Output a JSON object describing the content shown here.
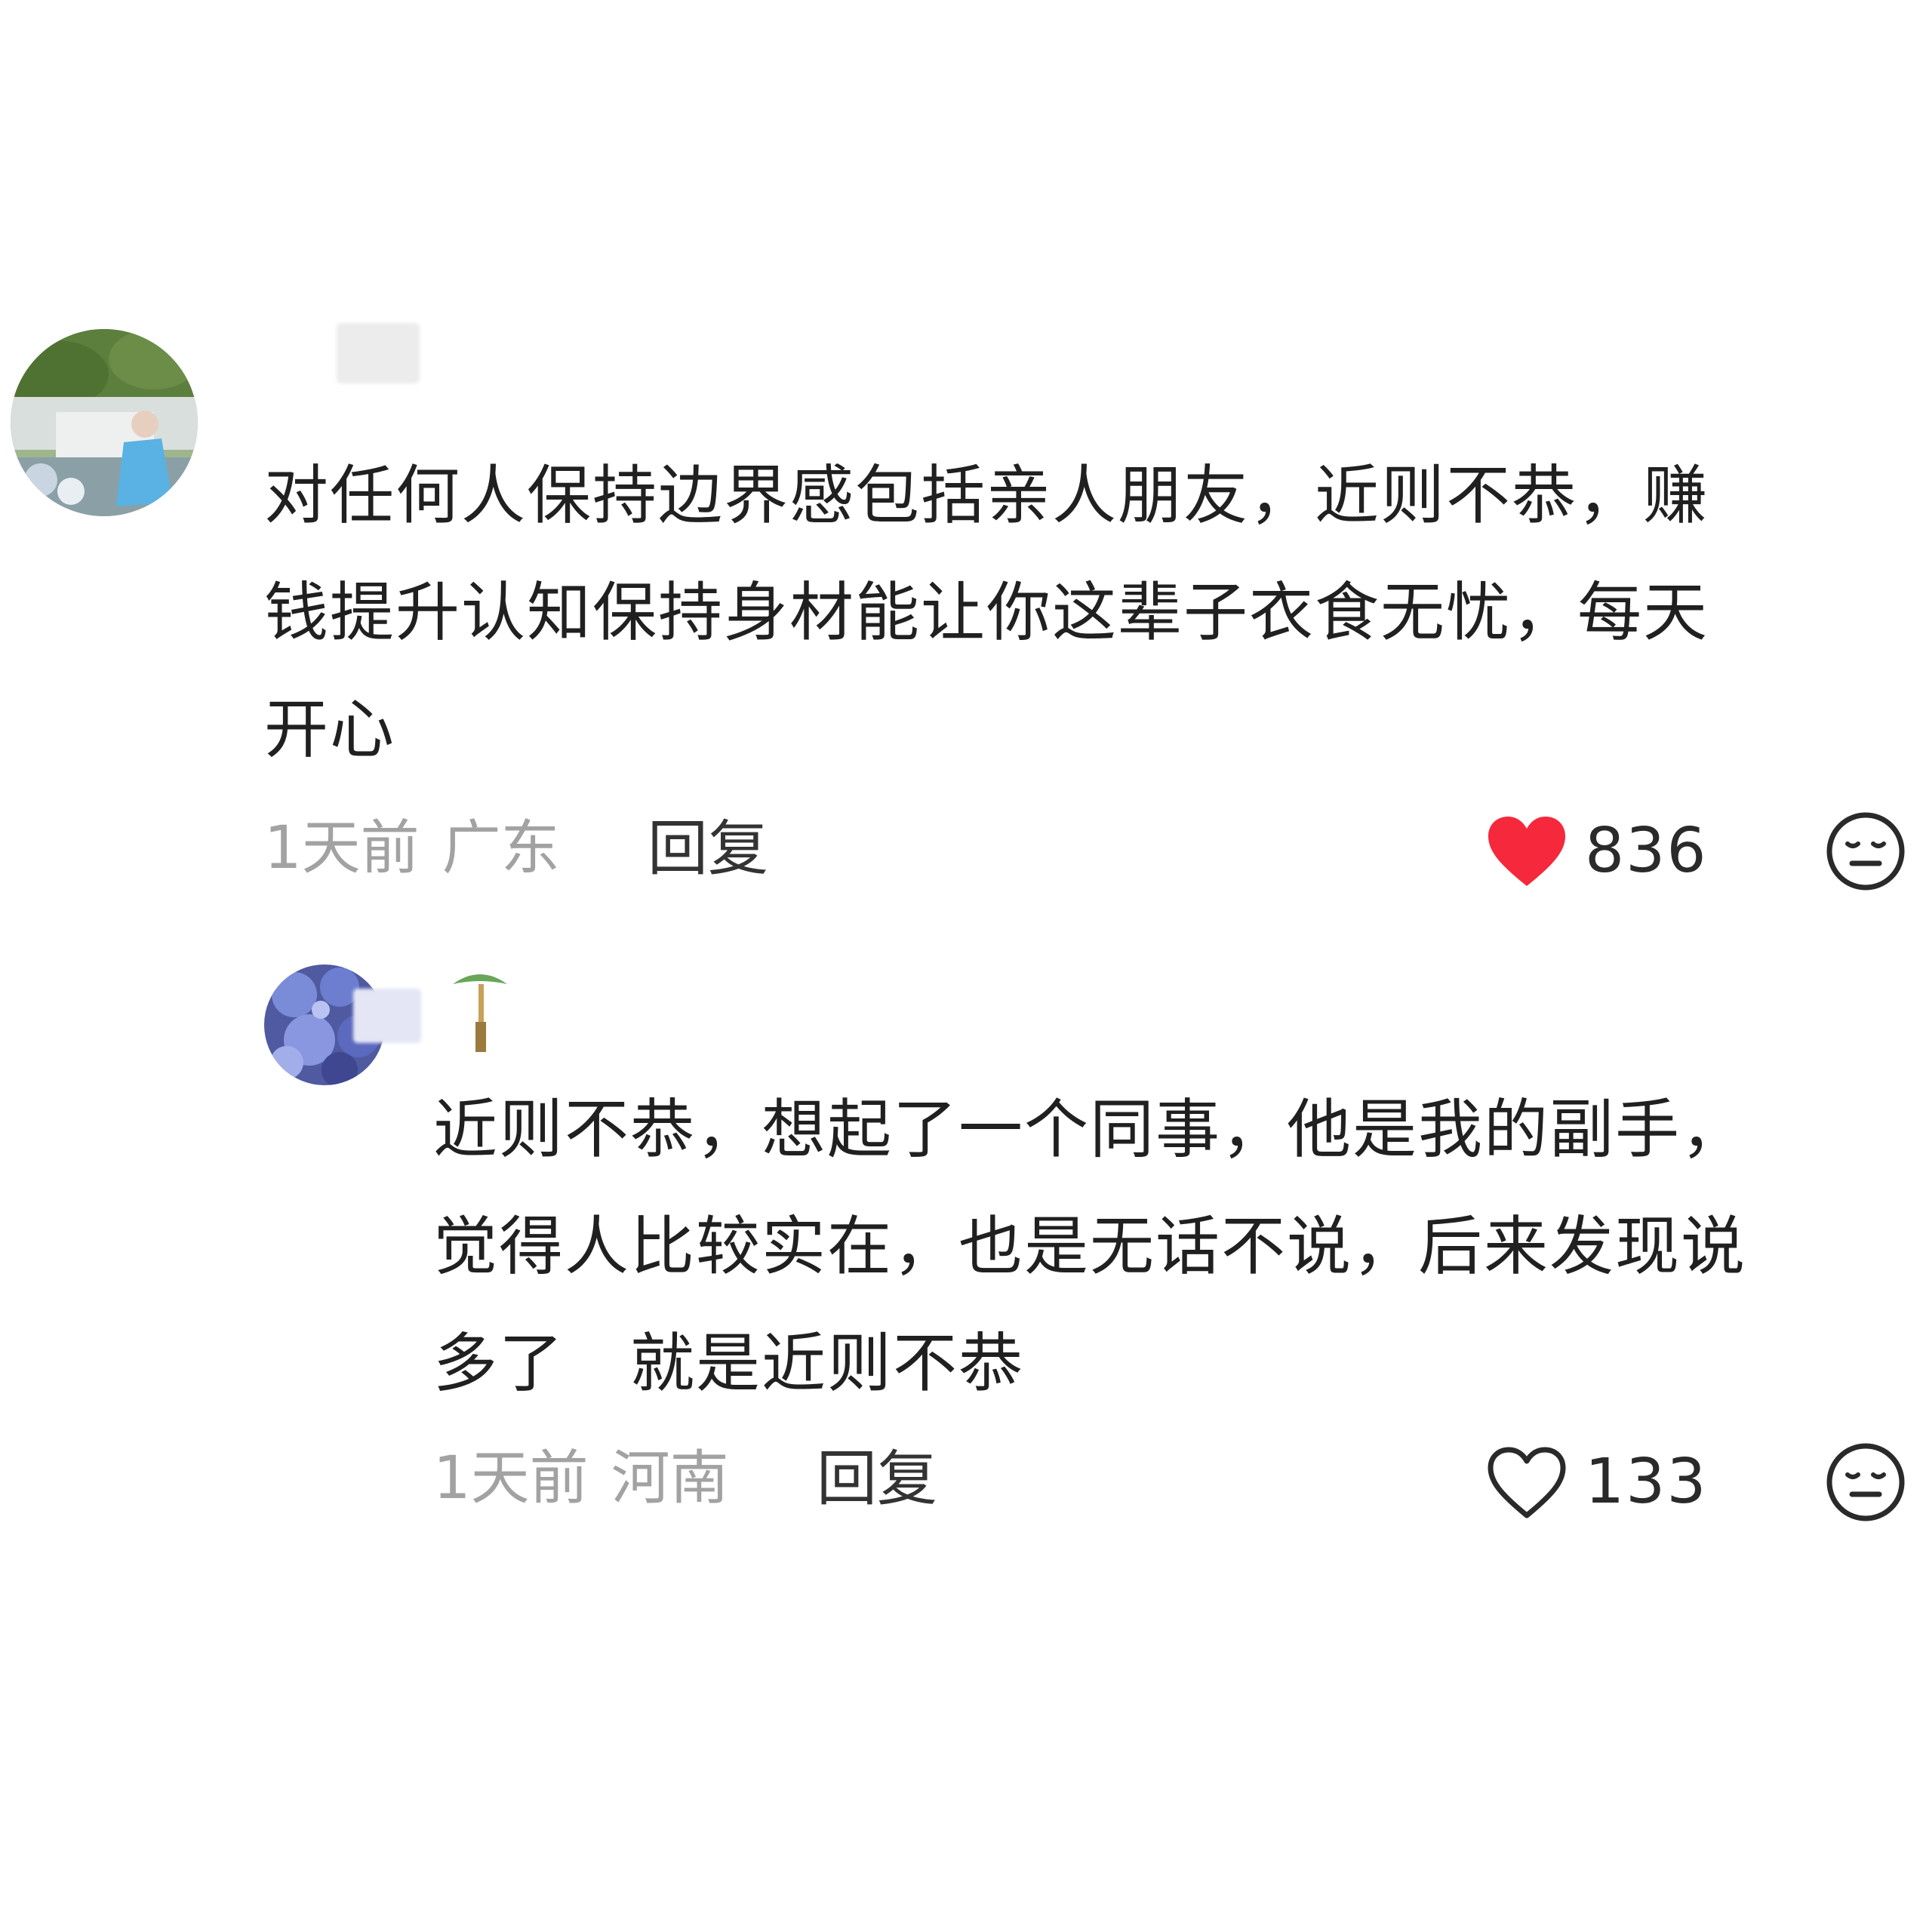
{
  "comments": [
    {
      "username": "",
      "text_lines": [
        "对任何人保持边界感包括亲人朋友，近则不恭，赚",
        "钱提升认知保持身材能让你这辈子衣食无忧，每天",
        "开心"
      ],
      "time": "1天前",
      "location": "广东",
      "reply_label": "回复",
      "likes": "836",
      "liked": true,
      "like_color": "#f5283c"
    },
    {
      "username": "",
      "text_lines": [
        "近则不恭，想起了一个同事，他是我的副手，",
        "觉得人比较实在，也是无话不说，后来发现说",
        "多了　就是近则不恭"
      ],
      "time": "1天前",
      "location": "河南",
      "reply_label": "回复",
      "likes": "133",
      "liked": false,
      "like_color": "#2a2a2a"
    }
  ],
  "icons": {
    "like": "heart-icon",
    "emoji": "emoji-face-icon"
  }
}
